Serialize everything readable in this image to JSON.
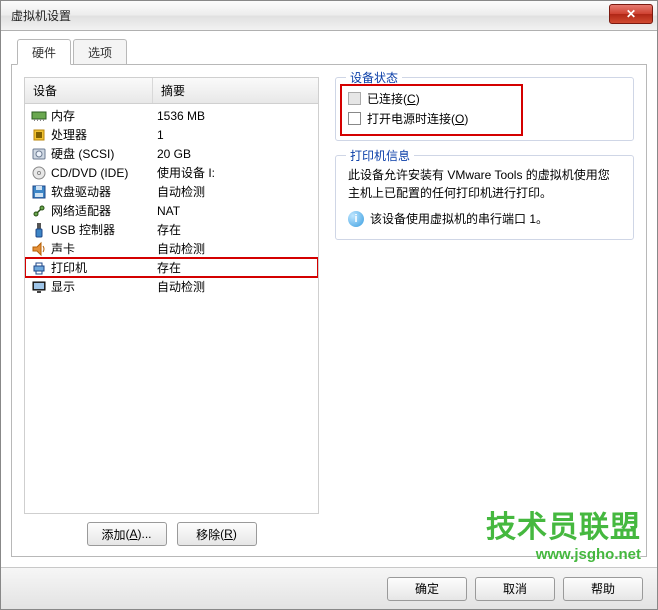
{
  "window": {
    "title": "虚拟机设置"
  },
  "tabs": [
    {
      "label": "硬件",
      "active": true
    },
    {
      "label": "选项",
      "active": false
    }
  ],
  "deviceList": {
    "headers": {
      "device": "设备",
      "summary": "摘要"
    },
    "rows": [
      {
        "icon": "memory-icon",
        "name": "内存",
        "summary": "1536 MB"
      },
      {
        "icon": "cpu-icon",
        "name": "处理器",
        "summary": "1"
      },
      {
        "icon": "disk-icon",
        "name": "硬盘 (SCSI)",
        "summary": "20 GB"
      },
      {
        "icon": "cd-icon",
        "name": "CD/DVD (IDE)",
        "summary": "使用设备 I:"
      },
      {
        "icon": "floppy-icon",
        "name": "软盘驱动器",
        "summary": "自动检测"
      },
      {
        "icon": "network-icon",
        "name": "网络适配器",
        "summary": "NAT"
      },
      {
        "icon": "usb-icon",
        "name": "USB 控制器",
        "summary": "存在"
      },
      {
        "icon": "sound-icon",
        "name": "声卡",
        "summary": "自动检测"
      },
      {
        "icon": "printer-icon",
        "name": "打印机",
        "summary": "存在",
        "selected": true
      },
      {
        "icon": "display-icon",
        "name": "显示",
        "summary": "自动检测"
      }
    ]
  },
  "statusGroup": {
    "legend": "设备状态",
    "connected": {
      "label": "已连接",
      "hotkey": "C",
      "checked": false,
      "enabled": false
    },
    "connectOnPower": {
      "label": "打开电源时连接",
      "hotkey": "O",
      "checked": false,
      "enabled": true
    }
  },
  "infoGroup": {
    "legend": "打印机信息",
    "para": "此设备允许安装有 VMware Tools 的虚拟机使用您主机上已配置的任何打印机进行打印。",
    "note": "该设备使用虚拟机的串行端口 1。"
  },
  "leftButtons": {
    "add": {
      "label": "添加",
      "hotkey": "A"
    },
    "remove": {
      "label": "移除",
      "hotkey": "R"
    }
  },
  "footerButtons": {
    "ok": "确定",
    "cancel": "取消",
    "help": "帮助"
  },
  "watermark": {
    "big": "技术员联盟",
    "url": "www.jsgho.net"
  }
}
